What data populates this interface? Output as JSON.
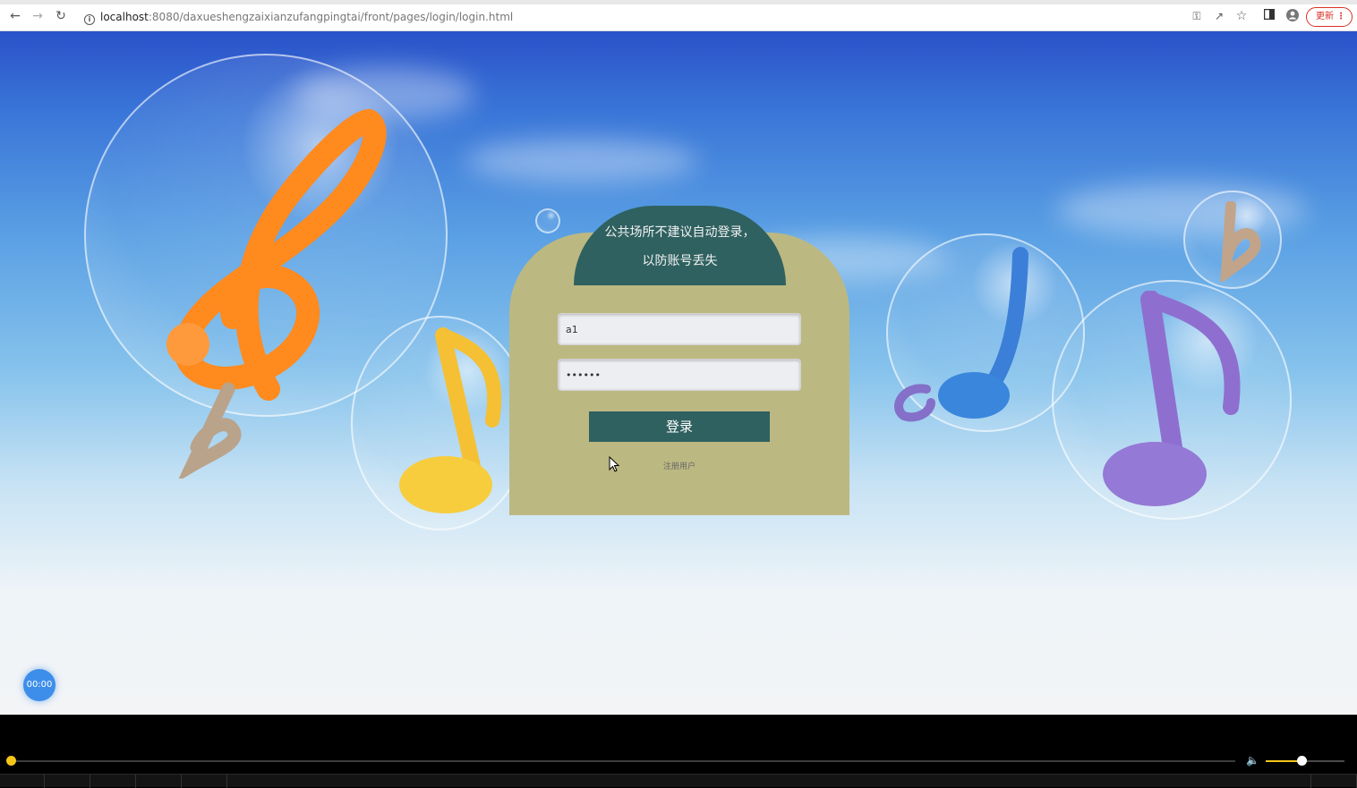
{
  "browser": {
    "url_host": "localhost",
    "url_path": ":8080/daxueshengzaixianzufangpingtai/front/pages/login/login.html",
    "update_label": "更新"
  },
  "login": {
    "notice": "公共场所不建议自动登录，以防账号丢失",
    "username_value": "a1",
    "password_value": "••••••",
    "login_label": "登录",
    "register_label": "注册用户"
  },
  "timer": {
    "label": "00:00"
  },
  "player": {
    "progress": 0,
    "volume": 0.45
  }
}
